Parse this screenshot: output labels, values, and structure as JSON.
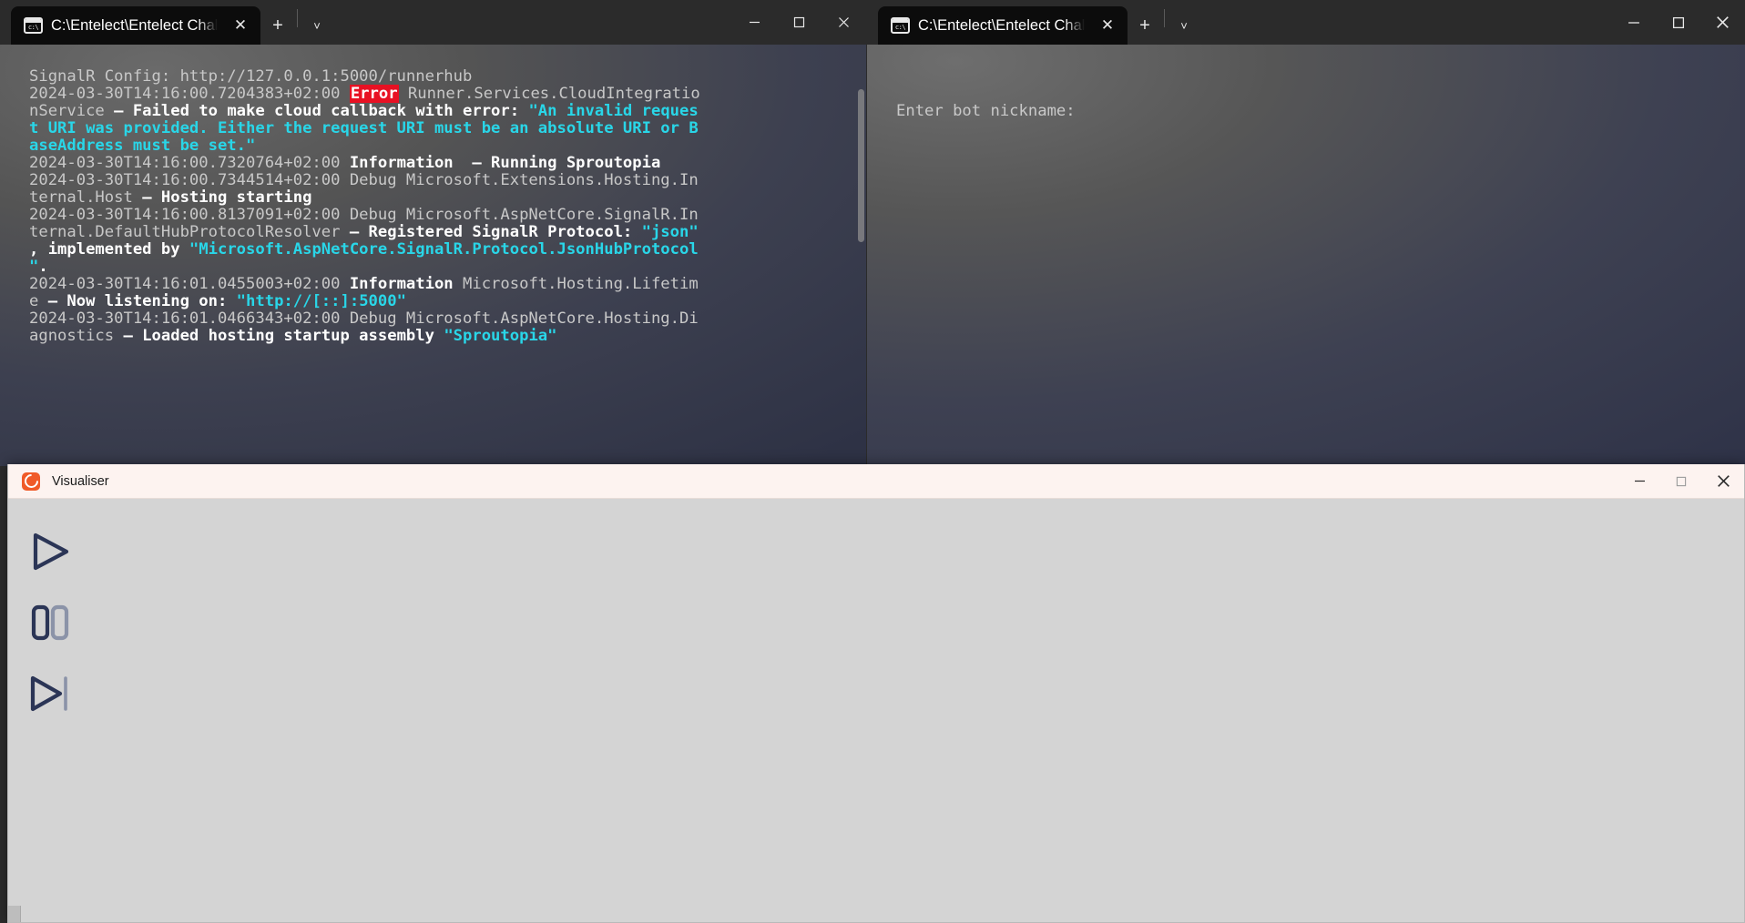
{
  "terminal_left": {
    "tab": {
      "title": "C:\\Entelect\\Entelect Challenge",
      "icon": "cmd-prompt-icon",
      "close_label": "✕",
      "new_tab_label": "+",
      "dropdown_label": "˅"
    },
    "window_controls": {
      "minimize": "minimize-icon",
      "maximize": "maximize-icon",
      "close": "close-icon"
    },
    "lines": [
      [
        {
          "t": "SignalR Config: http://127.0.0.1:5000/runnerhub",
          "c": "tk-dim"
        }
      ],
      [
        {
          "t": "2024-03-30T14:16:00.7204383+02:00 ",
          "c": "tk-dim"
        },
        {
          "t": "Error",
          "c": "tk-err"
        },
        {
          "t": " Runner.Services.CloudIntegratio",
          "c": "tk-dim"
        }
      ],
      [
        {
          "t": "nService ",
          "c": "tk-dim"
        },
        {
          "t": "— Failed to make cloud callback with error: ",
          "c": "tk-white"
        },
        {
          "t": "\"An invalid reques",
          "c": "tk-cyan"
        }
      ],
      [
        {
          "t": "t URI was provided. Either the request URI must be an absolute URI or B",
          "c": "tk-cyan"
        }
      ],
      [
        {
          "t": "aseAddress must be set.\"",
          "c": "tk-cyan"
        }
      ],
      [
        {
          "t": "2024-03-30T14:16:00.7320764+02:00 ",
          "c": "tk-dim"
        },
        {
          "t": "Information",
          "c": "tk-white"
        },
        {
          "t": "  ",
          "c": "tk-dim"
        },
        {
          "t": "— Running Sproutopia",
          "c": "tk-white"
        }
      ],
      [
        {
          "t": "2024-03-30T14:16:00.7344514+02:00 Debug Microsoft.Extensions.Hosting.In",
          "c": "tk-dim"
        }
      ],
      [
        {
          "t": "ternal.Host ",
          "c": "tk-dim"
        },
        {
          "t": "— Hosting starting",
          "c": "tk-white"
        }
      ],
      [
        {
          "t": "2024-03-30T14:16:00.8137091+02:00 Debug Microsoft.AspNetCore.SignalR.In",
          "c": "tk-dim"
        }
      ],
      [
        {
          "t": "ternal.DefaultHubProtocolResolver ",
          "c": "tk-dim"
        },
        {
          "t": "— Registered SignalR Protocol: ",
          "c": "tk-white"
        },
        {
          "t": "\"json\"",
          "c": "tk-cyan"
        }
      ],
      [
        {
          "t": ", implemented by ",
          "c": "tk-white"
        },
        {
          "t": "\"Microsoft.AspNetCore.SignalR.Protocol.JsonHubProtocol",
          "c": "tk-cyan"
        }
      ],
      [
        {
          "t": "\"",
          "c": "tk-cyan"
        },
        {
          "t": ".",
          "c": "tk-white"
        }
      ],
      [
        {
          "t": "2024-03-30T14:16:01.0455003+02:00 ",
          "c": "tk-dim"
        },
        {
          "t": "Information",
          "c": "tk-white"
        },
        {
          "t": " Microsoft.Hosting.Lifetim",
          "c": "tk-dim"
        }
      ],
      [
        {
          "t": "e ",
          "c": "tk-dim"
        },
        {
          "t": "— Now listening on: ",
          "c": "tk-white"
        },
        {
          "t": "\"http://[::]:5000\"",
          "c": "tk-cyan"
        }
      ],
      [
        {
          "t": "2024-03-30T14:16:01.0466343+02:00 Debug Microsoft.AspNetCore.Hosting.Di",
          "c": "tk-dim"
        }
      ],
      [
        {
          "t": "agnostics ",
          "c": "tk-dim"
        },
        {
          "t": "— Loaded hosting startup assembly ",
          "c": "tk-white"
        },
        {
          "t": "\"Sproutopia\"",
          "c": "tk-cyan"
        }
      ]
    ]
  },
  "terminal_right": {
    "tab": {
      "title": "C:\\Entelect\\Entelect Challenge",
      "icon": "cmd-prompt-icon",
      "close_label": "✕",
      "new_tab_label": "+",
      "dropdown_label": "˅"
    },
    "window_controls": {
      "minimize": "minimize-icon",
      "maximize": "maximize-icon",
      "close": "close-icon"
    },
    "prompt": "Enter bot nickname:"
  },
  "visualiser": {
    "title": "Visualiser",
    "logo": "visualiser-logo-icon",
    "window_controls": {
      "minimize": "minimize-icon",
      "maximize": "maximize-icon",
      "close": "close-icon"
    },
    "buttons": [
      {
        "name": "play-button",
        "icon": "play-icon"
      },
      {
        "name": "pause-button",
        "icon": "pause-icon"
      },
      {
        "name": "step-next-button",
        "icon": "step-forward-icon"
      }
    ]
  },
  "colors": {
    "error_badge": "#e81123",
    "cyan_token": "#29d6e8",
    "visualiser_accent": "#f05a28",
    "visualiser_icon": "#2b3556",
    "visualiser_bg": "#d4d4d4"
  }
}
